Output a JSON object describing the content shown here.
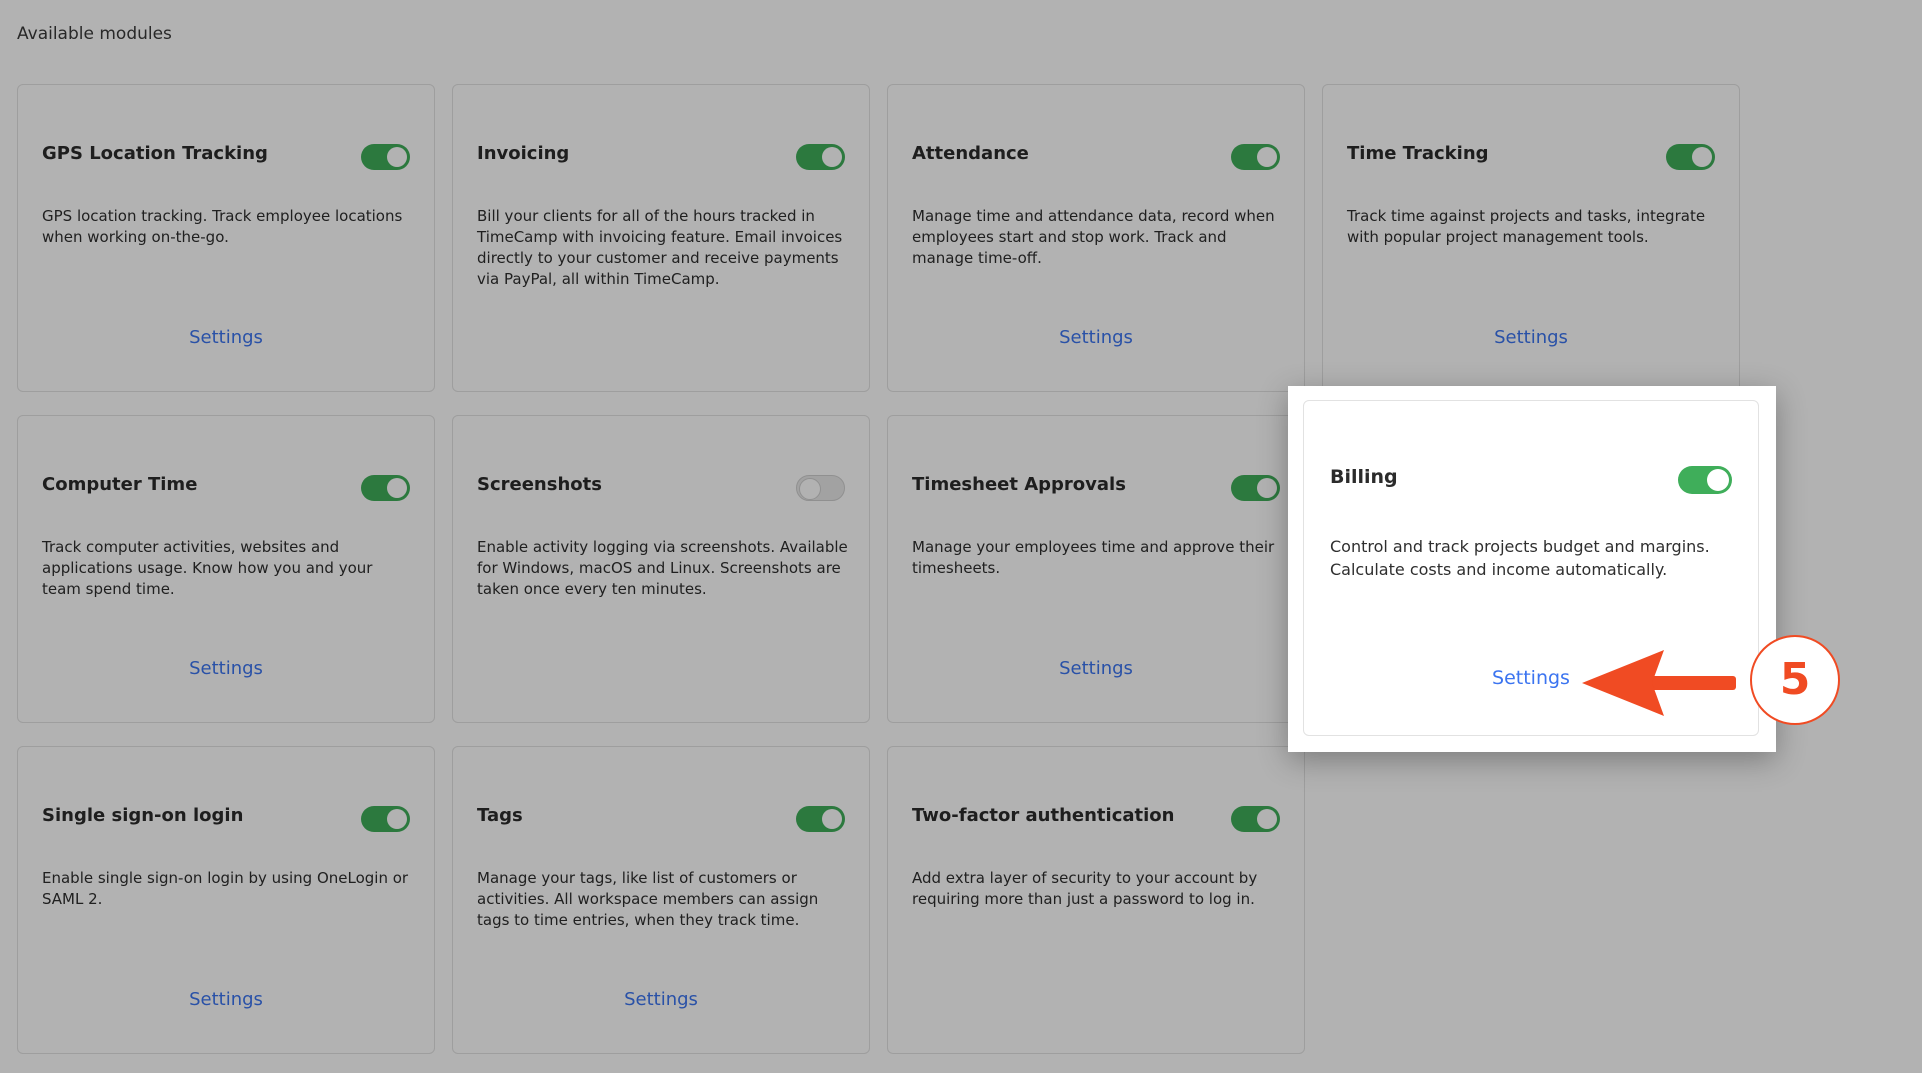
{
  "section_title": "Available modules",
  "settings_label": "Settings",
  "modules": [
    {
      "title": "GPS Location Tracking",
      "enabled": true,
      "description": "GPS location tracking. Track employee locations when working on-the-go.",
      "settings": "Settings"
    },
    {
      "title": "Invoicing",
      "enabled": true,
      "description": "Bill your clients for all of the hours tracked in TimeCamp with invoicing feature. Email invoices directly to your customer and receive payments via PayPal, all within TimeCamp.",
      "settings": ""
    },
    {
      "title": "Attendance",
      "enabled": true,
      "description": "Manage time and attendance data, record when employees start and stop work. Track and manage time-off.",
      "settings": "Settings"
    },
    {
      "title": "Time Tracking",
      "enabled": true,
      "description": "Track time against projects and tasks, integrate with popular project management tools.",
      "settings": "Settings"
    },
    {
      "title": "Computer Time",
      "enabled": true,
      "description": "Track computer activities, websites and applications usage. Know how you and your team spend time.",
      "settings": "Settings"
    },
    {
      "title": "Screenshots",
      "enabled": false,
      "description": "Enable activity logging via screenshots. Available for Windows, macOS and Linux. Screenshots are taken once every ten minutes.",
      "settings": ""
    },
    {
      "title": "Timesheet Approvals",
      "enabled": true,
      "description": "Manage your employees time and approve their timesheets.",
      "settings": "Settings"
    },
    {
      "title": "Single sign-on login",
      "enabled": true,
      "description": "Enable single sign-on login by using OneLogin or SAML 2.",
      "settings": "Settings"
    },
    {
      "title": "Tags",
      "enabled": true,
      "description": "Manage your tags, like list of customers or activities. All workspace members can assign tags to time entries, when they track time.",
      "settings": "Settings"
    },
    {
      "title": "Two-factor authentication",
      "enabled": true,
      "description": "Add extra layer of security to your account by requiring more than just a password to log in.",
      "settings": ""
    }
  ],
  "highlight": {
    "title": "Billing",
    "enabled": true,
    "description": "Control and track projects budget and margins. Calculate costs and income automatically.",
    "settings": "Settings"
  },
  "callout": {
    "step": "5"
  },
  "colors": {
    "toggle_on": "#3fae5a",
    "link": "#3b74f0",
    "callout": "#f04b23"
  }
}
